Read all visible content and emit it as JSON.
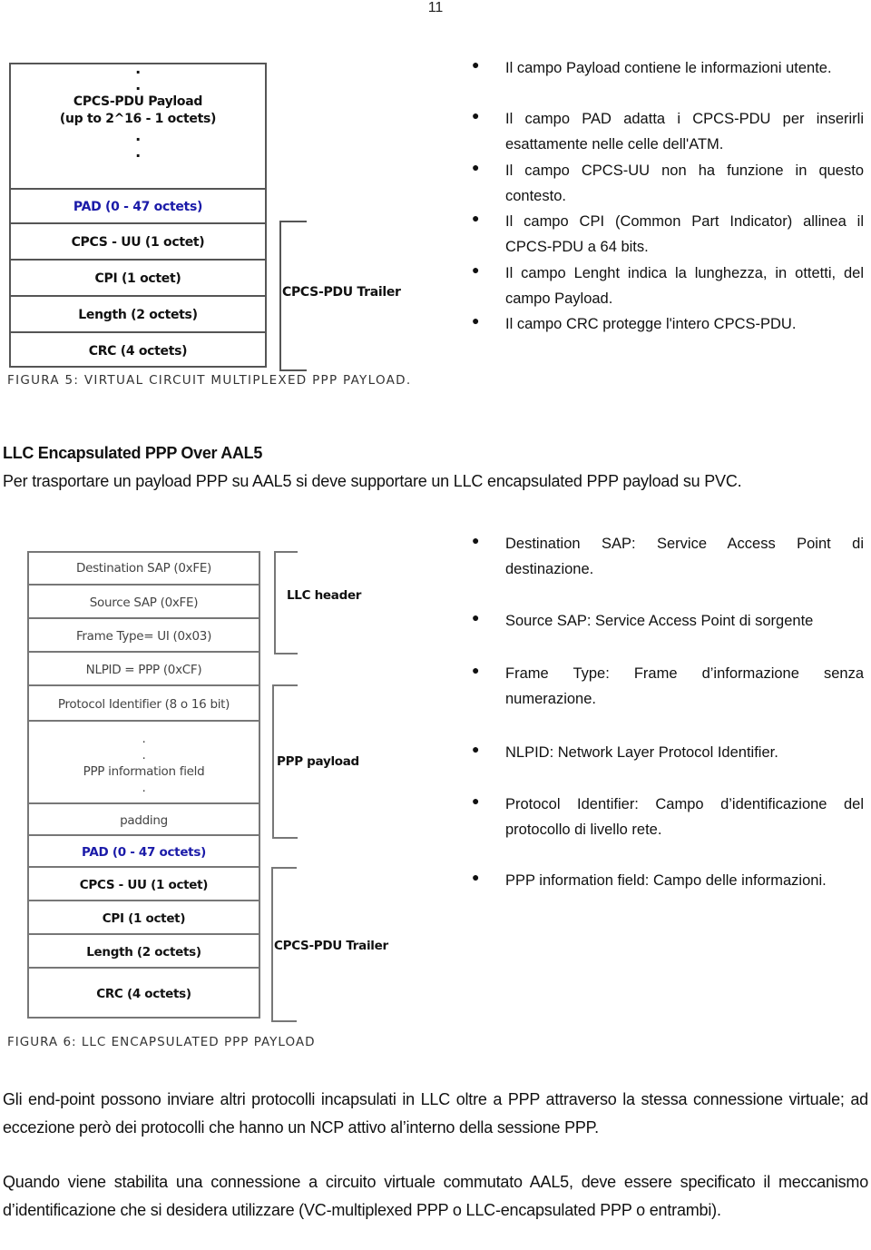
{
  "page_number": "11",
  "figure5": {
    "payload_dots": [
      ".",
      "."
    ],
    "payload_label": "CPCS-PDU Payload",
    "payload_sub": "(up to 2^16 - 1 octets)",
    "payload_dots_after": [
      ".",
      "."
    ],
    "pad": "PAD (0 - 47 octets)",
    "cpcs_uu": "CPCS - UU (1 octet)",
    "cpi": "CPI (1 octet)",
    "length": "Length (2 octets)",
    "crc": "CRC (4 octets)",
    "trailer_label": "CPCS-PDU Trailer",
    "colors": {
      "pad": "#1a1aa8",
      "border": "#555555"
    },
    "caption": "FIGURA 5: VIRTUAL CIRCUIT MULTIPLEXED PPP PAYLOAD."
  },
  "bullets_top": [
    "Il campo Payload contiene le informazioni utente.",
    "Il campo PAD adatta i CPCS-PDU per inserirli esattamente nelle celle dell'ATM.",
    "Il campo CPCS-UU non ha funzione in questo contesto.",
    " Il campo CPI (Common Part Indicator) allinea il CPCS-PDU a 64 bits.",
    "Il campo Lenght indica la lunghezza, in ottetti, del campo Payload.",
    "Il campo CRC protegge l'intero CPCS-PDU."
  ],
  "section": {
    "heading": "LLC Encapsulated PPP Over AAL5",
    "intro": "Per trasportare un payload PPP su AAL5 si deve supportare un LLC encapsulated PPP payload su PVC."
  },
  "figure6": {
    "dest_sap": "Destination SAP (0xFE)",
    "source_sap": "Source SAP (0xFE)",
    "frame_type": "Frame Type= UI  (0x03)",
    "nlpid": "NLPID = PPP (0xCF)",
    "protocol_id": "Protocol Identifier (8 o 16 bit)",
    "info_dots_before": [
      ".",
      "."
    ],
    "info_field": "PPP  information field",
    "info_dots_after": [
      "."
    ],
    "padding": "padding",
    "pad": "PAD (0 - 47 octets)",
    "cpcs_uu": "CPCS - UU (1 octet)",
    "cpi": "CPI (1 octet)",
    "length": "Length (2 octets)",
    "crc": "CRC (4 octets)",
    "llc_header_label": "LLC header",
    "ppp_payload_label": "PPP payload",
    "trailer_label": "CPCS-PDU Trailer",
    "caption": "FIGURA 6: LLC ENCAPSULATED PPP PAYLOAD"
  },
  "bullets_bottom": [
    "Destination SAP: Service Access Point di destinazione.",
    "Source SAP: Service Access Point di sorgente",
    "Frame Type:  Frame d’informazione senza numerazione.",
    "NLPID: Network Layer Protocol Identifier.",
    "Protocol Identifier: Campo d’identificazione del protocollo di livello rete.",
    "PPP information field: Campo delle informazioni."
  ],
  "bullet_glyph": "●",
  "paragraphs": [
    "Gli end-point possono inviare altri protocolli incapsulati in LLC oltre a PPP attraverso la stessa connessione virtuale; ad eccezione però dei protocolli che hanno un NCP attivo al’interno della sessione PPP.",
    "Quando viene stabilita una connessione a circuito virtuale commutato AAL5, deve essere specificato il meccanismo d’identificazione che si desidera utilizzare (VC-multiplexed PPP o LLC-encapsulated PPP o entrambi)."
  ]
}
